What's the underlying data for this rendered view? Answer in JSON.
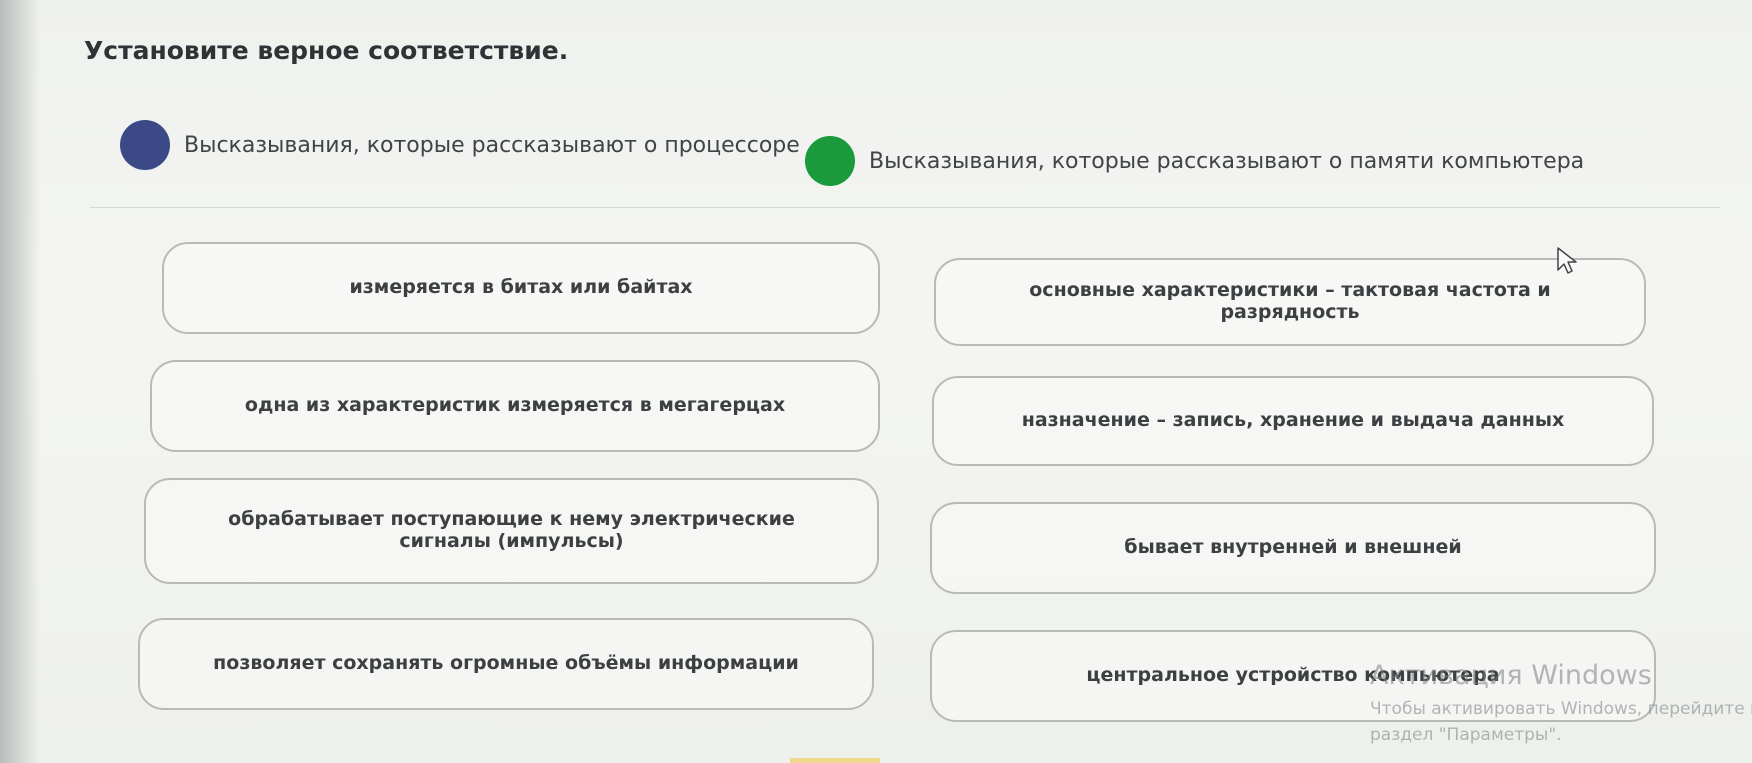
{
  "title": "Установите верное соответствие.",
  "legend": [
    {
      "label": "Высказывания, которые рассказывают о процессоре",
      "color": "#3b4a86"
    },
    {
      "label": "Высказывания, которые рассказывают о памяти компьютера",
      "color": "#1a9a3a"
    }
  ],
  "cards": [
    "измеряется в битах или байтах",
    "основные характеристики – тактовая частота и разрядность",
    "одна из характеристик измеряется в мегагерцах",
    "назначение – запись, хранение и выдача данных",
    "обрабатывает поступающие к нему электрические сигналы (импульсы)",
    "бывает внутренней и внешней",
    "позволяет сохранять огромные объёмы информации",
    "центральное устройство компьютера"
  ],
  "watermark": {
    "line1": "Активация Windows",
    "line2": "Чтобы активировать Windows, перейдите в",
    "line3": "раздел \"Параметры\"."
  },
  "icons": {
    "cursor": "mouse-pointer-icon"
  }
}
